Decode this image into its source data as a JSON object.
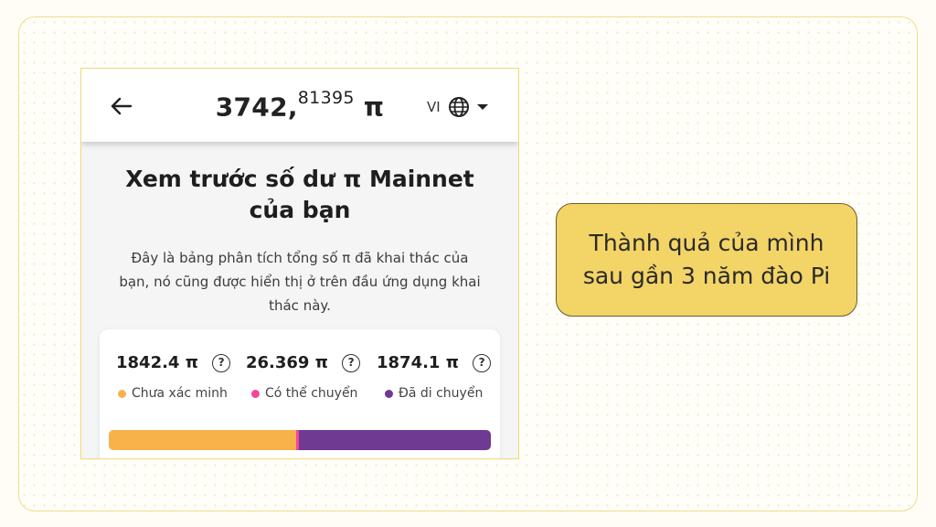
{
  "appbar": {
    "balance_integer": "3742,",
    "balance_decimal": "81395",
    "balance_unit": "π",
    "language_code": "VI"
  },
  "main": {
    "heading": "Xem trước số dư π Mainnet của bạn",
    "description": "Đây là bảng phân tích tổng số π đã khai thác của bạn, nó cũng được hiển thị ở trên đầu ứng dụng khai thác này."
  },
  "stats": [
    {
      "value": "1842.4 π",
      "label": "Chưa xác minh",
      "color": "#f7b24a"
    },
    {
      "value": "26.369 π",
      "label": "Có thể chuyển",
      "color": "#f2459b"
    },
    {
      "value": "1874.1 π",
      "label": "Đã di chuyển",
      "color": "#6f3a92"
    }
  ],
  "balance_bar": {
    "segments": [
      {
        "name": "Chưa xác minh",
        "fraction": 0.4916,
        "color": "#f7b24a"
      },
      {
        "name": "Có thể chuyển",
        "fraction": 0.007,
        "color": "#f2459b"
      },
      {
        "name": "Đã di chuyển",
        "fraction": 0.5014,
        "color": "#6f3a92"
      }
    ]
  },
  "callout": {
    "text_line1": "Thành quả của mình",
    "text_line2": "sau gần 3 năm đào Pi"
  },
  "icons": {
    "back": "back-arrow-icon",
    "globe": "globe-icon",
    "caret": "caret-down-icon",
    "help": "help-circle-icon"
  },
  "help_glyph": "?"
}
